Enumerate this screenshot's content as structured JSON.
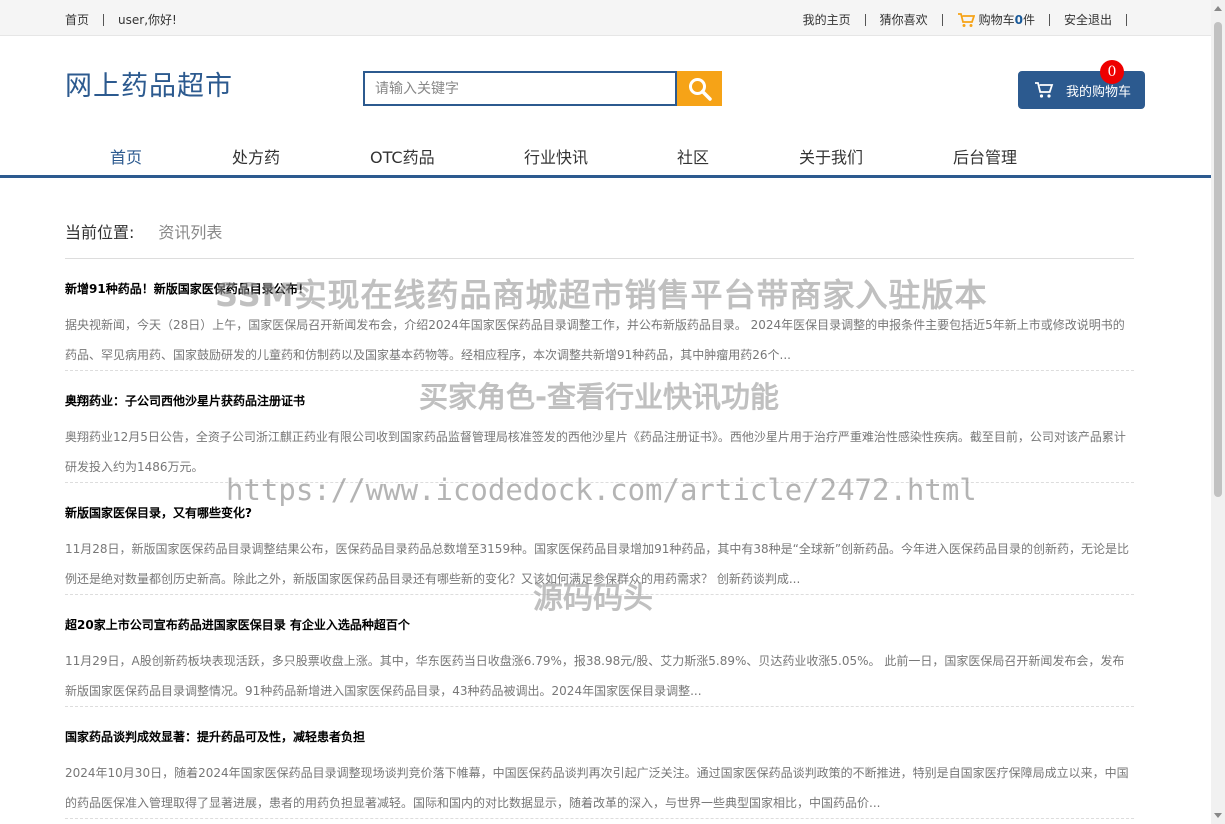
{
  "topbar": {
    "home": "首页",
    "greeting": "user,你好!",
    "my_home": "我的主页",
    "guess": "猜你喜欢",
    "cart_prefix": "购物车",
    "cart_count": "0",
    "cart_suffix": "件",
    "logout": "安全退出"
  },
  "header": {
    "logo": "网上药品超市",
    "search_placeholder": "请输入关键字",
    "cart_button": "我的购物车",
    "cart_badge": "0"
  },
  "nav": {
    "items": [
      {
        "label": "首页",
        "active": true
      },
      {
        "label": "处方药"
      },
      {
        "label": "OTC药品"
      },
      {
        "label": "行业快讯"
      },
      {
        "label": "社区"
      },
      {
        "label": "关于我们"
      },
      {
        "label": "后台管理"
      }
    ]
  },
  "breadcrumb": {
    "label": "当前位置:",
    "current": "资讯列表"
  },
  "news": [
    {
      "title": "新增91种药品！新版国家医保药品目录公布！",
      "summary": "据央视新闻，今天（28日）上午，国家医保局召开新闻发布会，介绍2024年国家医保药品目录调整工作，并公布新版药品目录。 2024年医保目录调整的申报条件主要包括近5年新上市或修改说明书的药品、罕见病用药、国家鼓励研发的儿童药和仿制药以及国家基本药物等。经相应程序，本次调整共新增91种药品，其中肿瘤用药26个..."
    },
    {
      "title": "奥翔药业：子公司西他沙星片获药品注册证书",
      "summary": "奥翔药业12月5日公告，全资子公司浙江麒正药业有限公司收到国家药品监督管理局核准签发的西他沙星片《药品注册证书》。西他沙星片用于治疗严重难治性感染性疾病。截至目前，公司对该产品累计研发投入约为1486万元。"
    },
    {
      "title": "新版国家医保目录，又有哪些变化?",
      "summary": "11月28日，新版国家医保药品目录调整结果公布，医保药品目录药品总数增至3159种。国家医保药品目录增加91种药品，其中有38种是“全球新”创新药品。今年进入医保药品目录的创新药，无论是比例还是绝对数量都创历史新高。除此之外，新版国家医保药品目录还有哪些新的变化？又该如何满足参保群众的用药需求？ 创新药谈判成..."
    },
    {
      "title": "超20家上市公司宣布药品进国家医保目录 有企业入选品种超百个",
      "summary": "11月29日，A股创新药板块表现活跃，多只股票收盘上涨。其中，华东医药当日收盘涨6.79%，报38.98元/股、艾力斯涨5.89%、贝达药业收涨5.05%。 此前一日，国家医保局召开新闻发布会，发布新版国家医保药品目录调整情况。91种药品新增进入国家医保药品目录，43种药品被调出。2024年国家医保目录调整..."
    },
    {
      "title": "国家药品谈判成效显著：提升药品可及性，减轻患者负担",
      "summary": "2024年10月30日，随着2024年国家医保药品目录调整现场谈判竞价落下帷幕，中国医保药品谈判再次引起广泛关注。通过国家医保药品谈判政策的不断推进，特别是自国家医疗保障局成立以来，中国的药品医保准入管理取得了显著进展，患者的用药负担显著减轻。国际和国内的对比数据显示，随着改革的深入，与世界一些典型国家相比，中国药品价..."
    }
  ],
  "watermark": {
    "line1": "SSM实现在线药品商城超市销售平台带商家入驻版本",
    "line2": "买家角色-查看行业快讯功能",
    "line3": "https://www.icodedock.com/article/2472.html",
    "line4": "源码码头"
  },
  "colors": {
    "brand": "#2c5a8f",
    "search_button": "#f6a317",
    "badge": "#ee0000"
  }
}
